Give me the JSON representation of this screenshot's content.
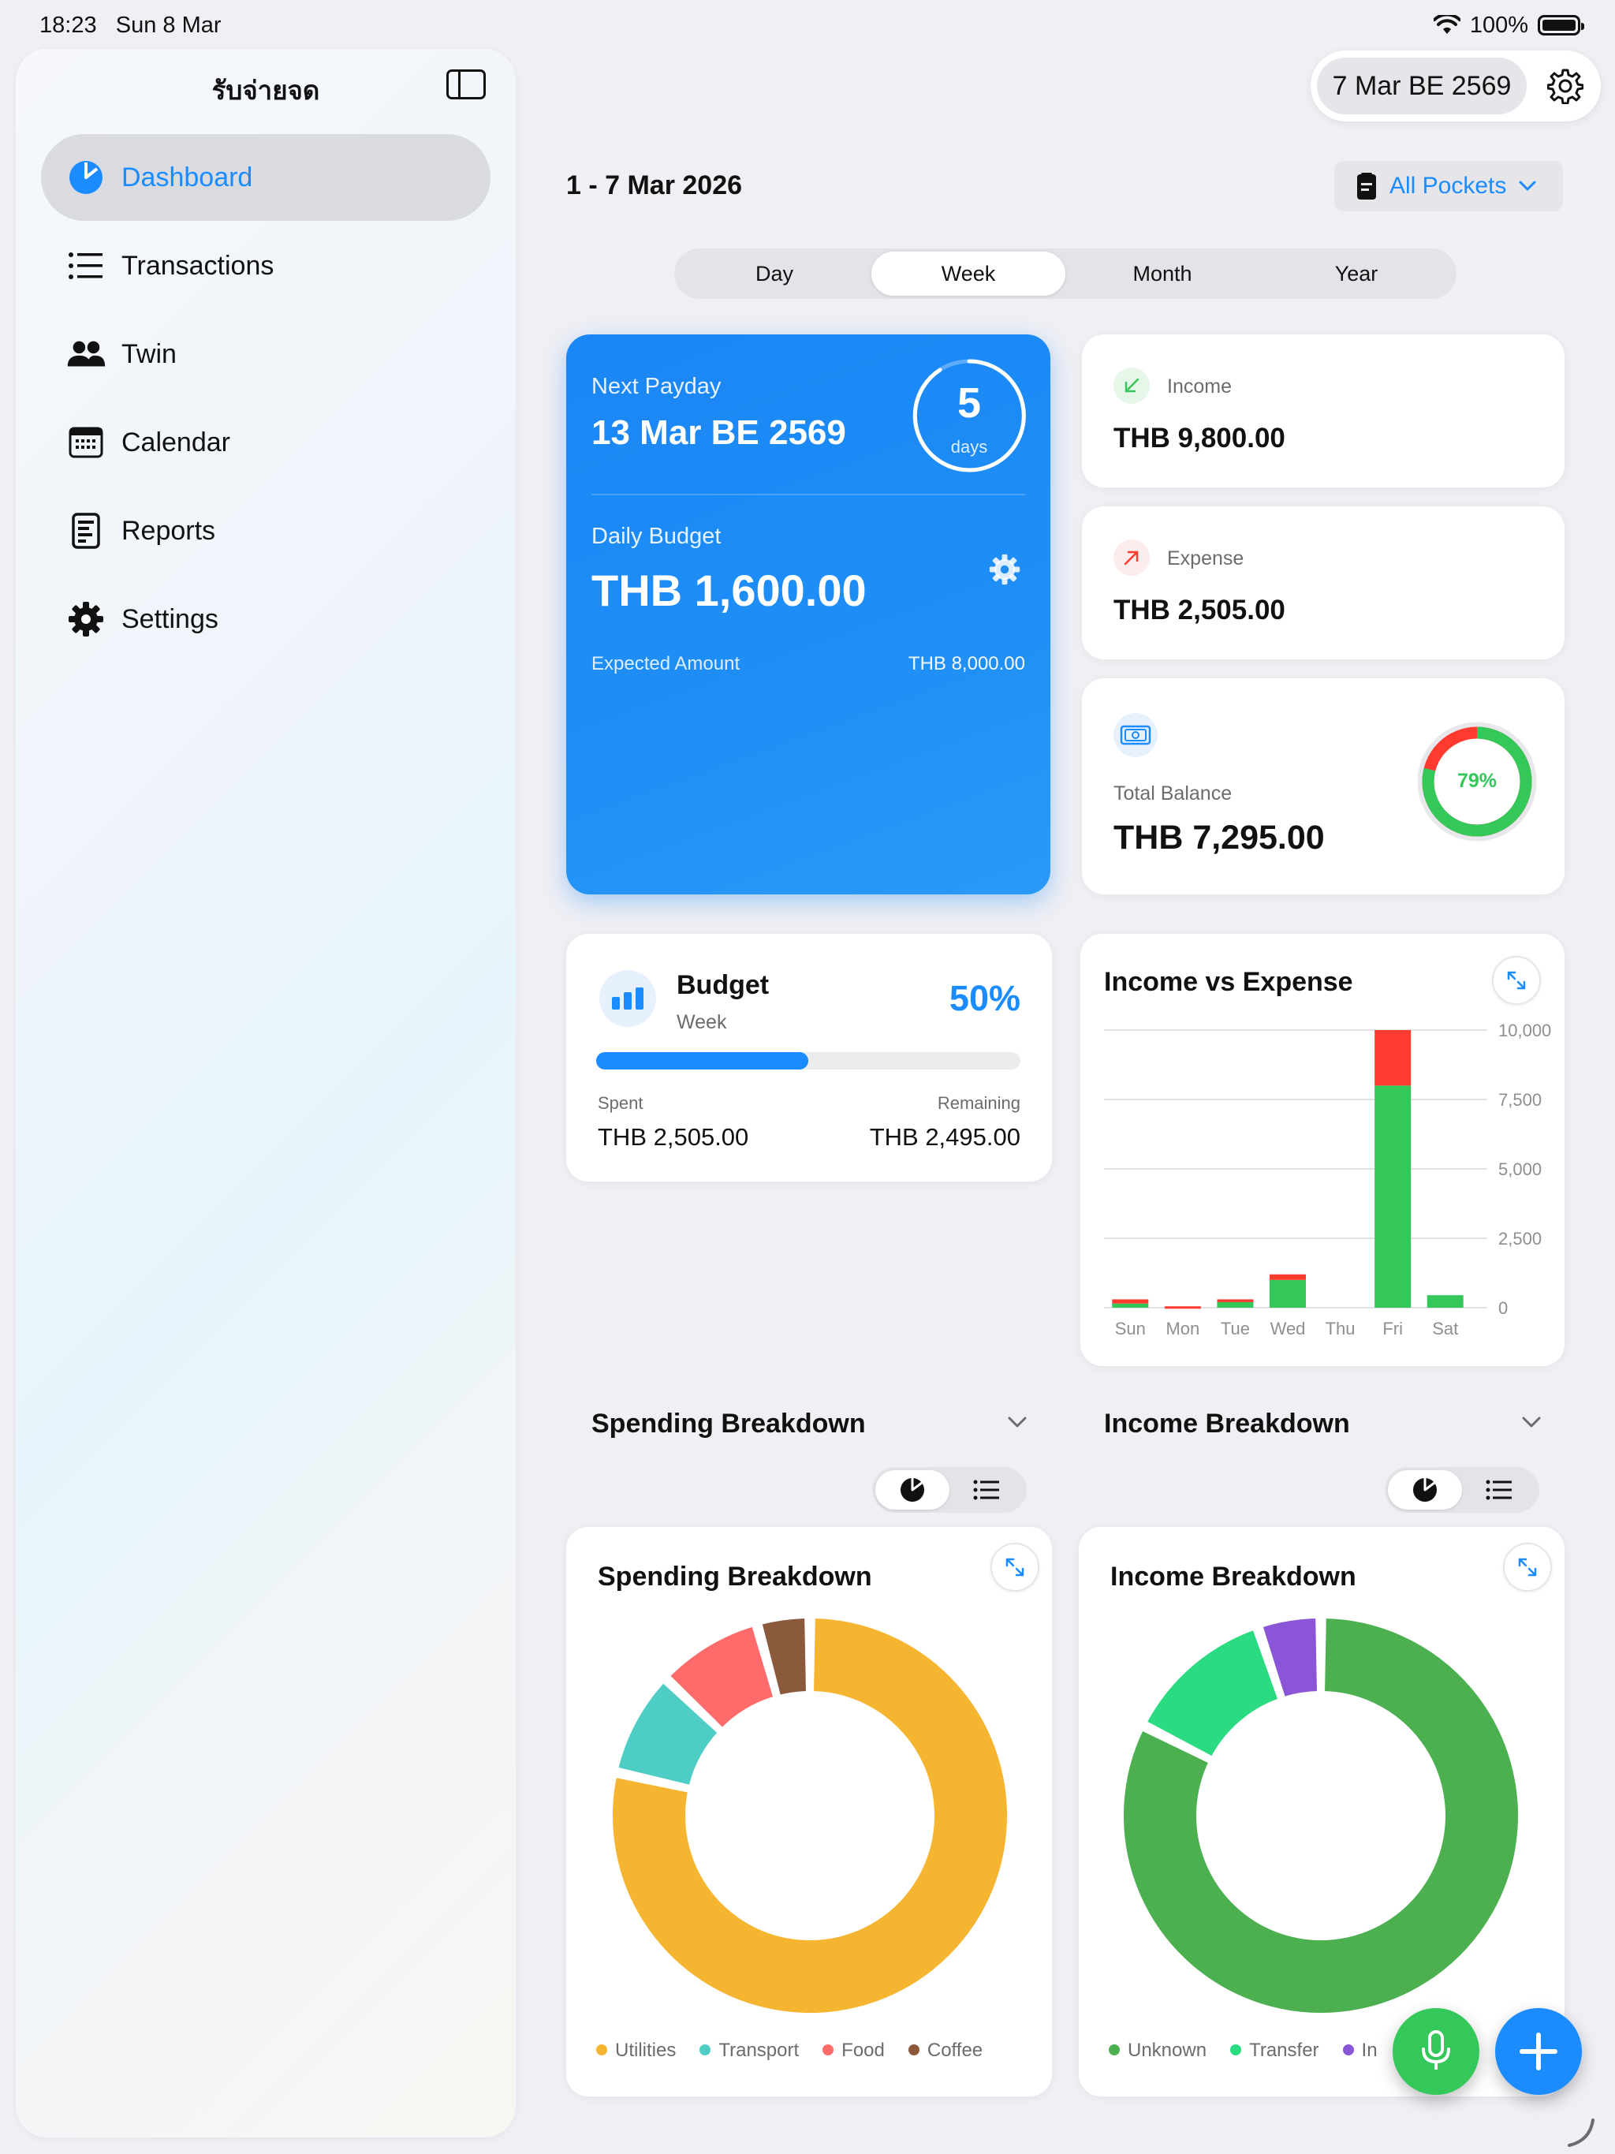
{
  "status_bar": {
    "time": "18:23",
    "date": "Sun 8 Mar",
    "battery": "100%"
  },
  "sidebar": {
    "app_title": "รับจ่ายจด",
    "items": [
      {
        "label": "Dashboard",
        "icon": "pie-chart-icon",
        "active": true
      },
      {
        "label": "Transactions",
        "icon": "list-icon"
      },
      {
        "label": "Twin",
        "icon": "people-icon"
      },
      {
        "label": "Calendar",
        "icon": "calendar-icon"
      },
      {
        "label": "Reports",
        "icon": "report-icon"
      },
      {
        "label": "Settings",
        "icon": "gear-icon"
      }
    ]
  },
  "header": {
    "current_date": "7 Mar BE 2569",
    "range_title": "1 - 7 Mar 2026",
    "pockets_label": "All Pockets",
    "periods": [
      "Day",
      "Week",
      "Month",
      "Year"
    ],
    "active_period": "Week"
  },
  "payday": {
    "label": "Next Payday",
    "date": "13 Mar BE 2569",
    "days_count": "5",
    "days_label": "days",
    "daily_budget_label": "Daily Budget",
    "daily_budget": "THB 1,600.00",
    "expected_label": "Expected Amount",
    "expected_value": "THB 8,000.00"
  },
  "income": {
    "label": "Income",
    "value": "THB 9,800.00"
  },
  "expense": {
    "label": "Expense",
    "value": "THB 2,505.00"
  },
  "balance": {
    "label": "Total Balance",
    "value": "THB 7,295.00",
    "percent_label": "79%",
    "percent": 79
  },
  "budget": {
    "title": "Budget",
    "subtitle": "Week",
    "percent_label": "50%",
    "progress": 0.5,
    "spent_label": "Spent",
    "spent_value": "THB 2,505.00",
    "remaining_label": "Remaining",
    "remaining_value": "THB 2,495.00"
  },
  "chart_data": [
    {
      "type": "bar",
      "title": "Income vs Expense",
      "categories": [
        "Sun",
        "Mon",
        "Tue",
        "Wed",
        "Thu",
        "Fri",
        "Sat"
      ],
      "series": [
        {
          "color": "#34c759",
          "values": [
            150,
            0,
            200,
            1000,
            0,
            8000,
            450
          ]
        },
        {
          "color": "#ff3b30",
          "values": [
            150,
            50,
            100,
            200,
            0,
            2000,
            0
          ]
        }
      ],
      "yticks": [
        "10,000",
        "7,500",
        "5,000",
        "2,500",
        "0"
      ],
      "ylim": [
        0,
        10000
      ],
      "grid": true,
      "stacked": true
    },
    {
      "type": "pie",
      "title": "Spending Breakdown",
      "labels": [
        "Utilities",
        "Transport",
        "Food",
        "Coffee"
      ],
      "values": [
        73,
        8,
        8,
        4
      ],
      "colors": [
        "#f6b530",
        "#4ecdc4",
        "#ff6b6b",
        "#8b5a3c"
      ]
    },
    {
      "type": "pie",
      "title": "Income Breakdown",
      "labels": [
        "Unknown",
        "Transfer",
        "In"
      ],
      "values": [
        80,
        12,
        5
      ],
      "colors": [
        "#4caf50",
        "#2bdb82",
        "#8a55d6"
      ]
    }
  ],
  "breakdown": {
    "spending_section": "Spending Breakdown",
    "income_section": "Income Breakdown"
  },
  "colors": {
    "accent": "#1a8cff",
    "income": "#34c759",
    "expense": "#ff3b30"
  }
}
